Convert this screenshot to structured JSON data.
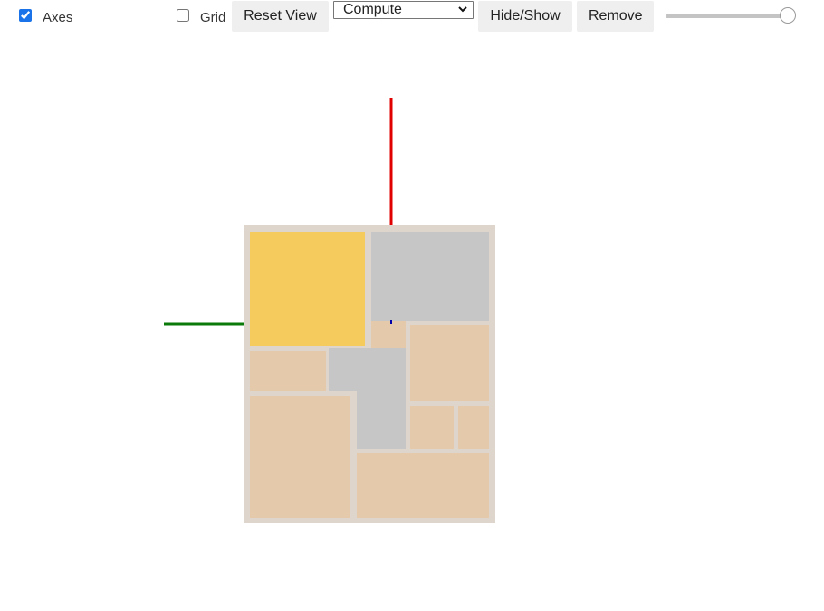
{
  "toolbar": {
    "axes_label": "Axes",
    "axes_checked": true,
    "grid_label": "Grid",
    "grid_checked": false,
    "reset_view_label": "Reset View",
    "mode_select_value": "Compute",
    "hide_show_label": "Hide/Show",
    "remove_label": "Remove",
    "slider_value_fraction": 0.95
  },
  "scene": {
    "colors": {
      "floor": "#ded6cc",
      "room_beige": "#e5c9ab",
      "room_gray": "#c6c6c6",
      "room_highlight": "#f6cb5e",
      "axis_x": "#e00000",
      "axis_y": "#0a7a0a",
      "axis_z": "#0000aa"
    },
    "rooms": [
      {
        "name": "room-highlight",
        "kind": "highlight"
      },
      {
        "name": "room-gray-top-right",
        "kind": "gray"
      },
      {
        "name": "room-small-connector",
        "kind": "beige"
      },
      {
        "name": "room-right-middle",
        "kind": "beige"
      },
      {
        "name": "room-left-small",
        "kind": "beige"
      },
      {
        "name": "room-gray-center",
        "kind": "gray"
      },
      {
        "name": "room-left-large",
        "kind": "beige"
      },
      {
        "name": "room-right-small-a",
        "kind": "beige"
      },
      {
        "name": "room-right-small-b",
        "kind": "beige"
      },
      {
        "name": "room-bottom-right",
        "kind": "beige"
      }
    ]
  }
}
